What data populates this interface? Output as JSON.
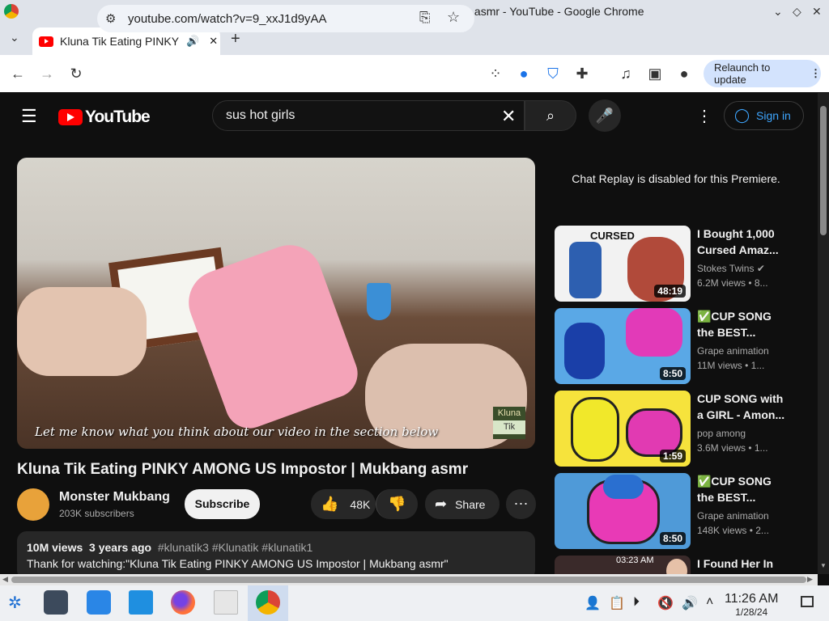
{
  "window": {
    "title": "Kluna Tik Eating PINKY AMONG US Impostor | Mukbang asmr - YouTube - Google Chrome"
  },
  "browser": {
    "tab_title": "Kluna Tik Eating PINKY A",
    "url": "youtube.com/watch?v=9_xxJ1d9yAA",
    "relaunch_label": "Relaunch to update"
  },
  "youtube": {
    "logo_text": "YouTube",
    "search_value": "sus hot girls",
    "signin_label": "Sign in"
  },
  "video": {
    "caption": "Let me know what you think about our video in the section below",
    "watermark_top": "Kluna",
    "watermark_bottom": "Tik",
    "title": "Kluna Tik Eating PINKY AMONG US Impostor | Mukbang asmr",
    "channel": "Monster Mukbang",
    "subscribers": "203K subscribers",
    "subscribe_label": "Subscribe",
    "likes": "48K",
    "share_label": "Share",
    "views": "10M views",
    "age": "3 years ago",
    "tags": "#klunatik3 #Klunatik #klunatik1",
    "description": "Thank for watching:\"Kluna Tik Eating PINKY AMONG US Impostor | Mukbang asmr\""
  },
  "sidebar": {
    "chat_replay": "Chat Replay is disabled for this Premiere.",
    "recommendations": [
      {
        "title": "I Bought 1,000 Cursed Amaz...",
        "channel": "Stokes Twins",
        "meta": "6.2M views • 8...",
        "duration": "48:19",
        "thumb_label": "CURSED",
        "thumb_color": "#f2f2f2"
      },
      {
        "title": "✅CUP SONG the BEST...",
        "channel": "Grape animation",
        "meta": "11M views • 1...",
        "duration": "8:50",
        "thumb_color": "#5aa8e6"
      },
      {
        "title": "CUP SONG with a GIRL - Amon...",
        "channel": "pop among",
        "meta": "3.6M views • 1...",
        "duration": "1:59",
        "thumb_color": "#f6e33c"
      },
      {
        "title": "✅CUP SONG the BEST...",
        "channel": "Grape animation",
        "meta": "148K views • 2...",
        "duration": "8:50",
        "thumb_color": "#4f9ad8"
      },
      {
        "title": "I Found Her In",
        "duration": "03:23 AM",
        "thumb_color": "#3a2a2a"
      }
    ]
  },
  "taskbar": {
    "time": "11:26 AM",
    "date": "1/28/24"
  },
  "colors": {
    "youtube_red": "#ff0000",
    "link_blue": "#3ea6ff",
    "relaunch_bg": "#d3e3fd"
  }
}
